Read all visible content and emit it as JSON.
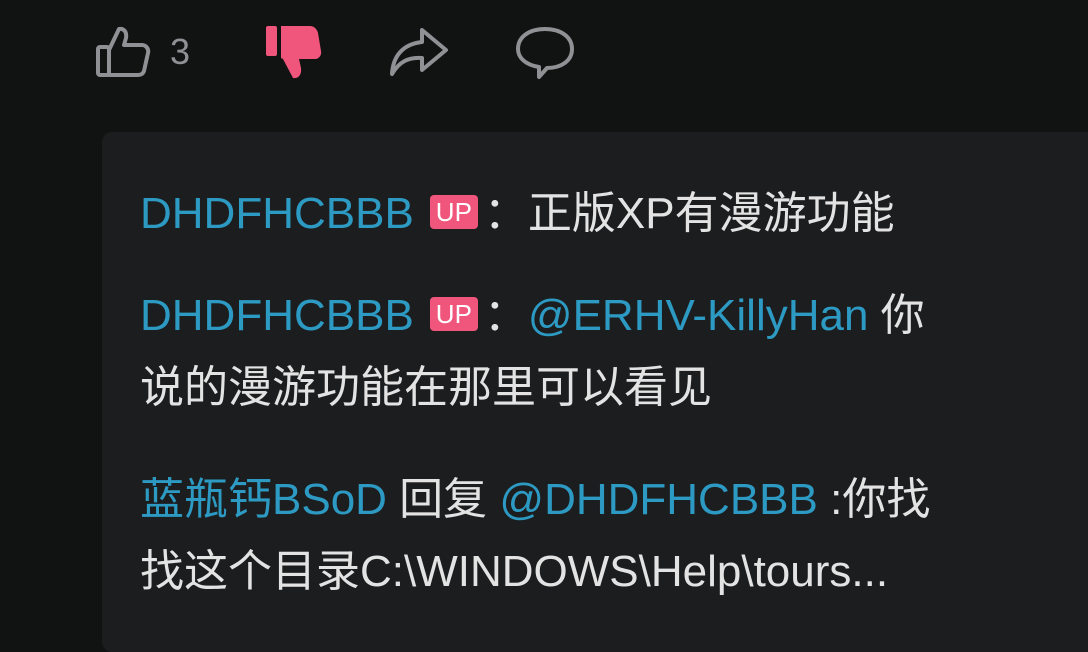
{
  "actions": {
    "like_count": "3"
  },
  "replies": [
    {
      "user": "DHDFHCBBB",
      "badge": "UP",
      "separator": "：",
      "line1_text": "正版XP有漫游功能"
    },
    {
      "user": "DHDFHCBBB",
      "badge": "UP",
      "separator": "：",
      "mention": "@ERHV-KillyHan",
      "line1_text": " 你",
      "line2_text": "说的漫游功能在那里可以看见"
    },
    {
      "user": "蓝瓶钙BSoD",
      "verb": " 回复 ",
      "mention": "@DHDFHCBBB",
      "line1_text": " :你找",
      "line2_text": "找这个目录C:\\WINDOWS\\Help\\tours..."
    }
  ],
  "colors": {
    "background": "#111212",
    "panel": "#1c1d1e",
    "username": "#2d9ac3",
    "badge": "#f0557c",
    "dislike_active": "#f0557c",
    "icon": "#8f9194"
  }
}
